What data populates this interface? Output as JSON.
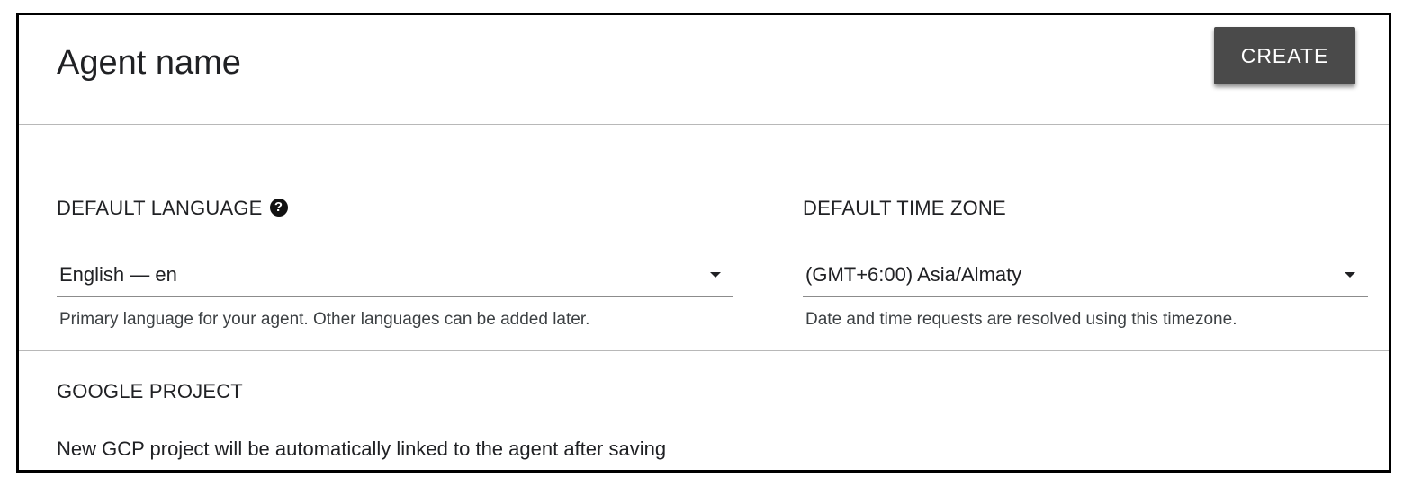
{
  "header": {
    "agent_name_placeholder": "Agent name",
    "create_label": "CREATE"
  },
  "language": {
    "label": "DEFAULT LANGUAGE",
    "help_icon": "question-circle-icon",
    "selected": "English — en",
    "hint": "Primary language for your agent. Other languages can be added later."
  },
  "timezone": {
    "label": "DEFAULT TIME ZONE",
    "selected": "(GMT+6:00) Asia/Almaty",
    "hint": "Date and time requests are resolved using this timezone."
  },
  "project": {
    "label": "GOOGLE PROJECT",
    "text": "New GCP project will be automatically linked to the agent after saving"
  },
  "colors": {
    "button_bg": "#4a4a4a",
    "divider": "#b8b8b8",
    "frame_border": "#000000"
  }
}
